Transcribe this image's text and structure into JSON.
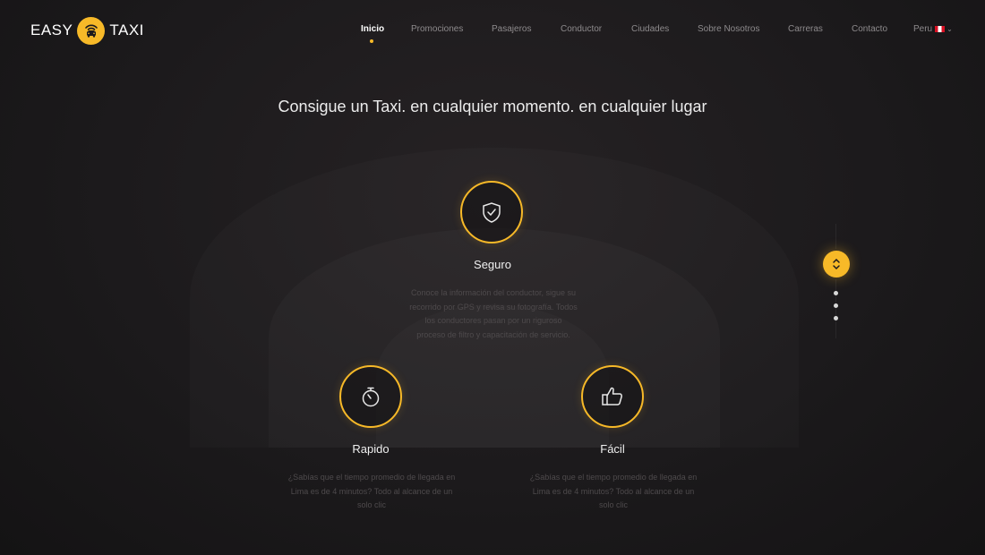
{
  "logo": {
    "left": "EASY",
    "right": "TAXI"
  },
  "nav": {
    "items": [
      {
        "label": "Inicio"
      },
      {
        "label": "Promociones"
      },
      {
        "label": "Pasajeros"
      },
      {
        "label": "Conductor"
      },
      {
        "label": "Ciudades"
      },
      {
        "label": "Sobre Nosotros"
      },
      {
        "label": "Carreras"
      },
      {
        "label": "Contacto"
      }
    ],
    "active_index": 0,
    "country": "Peru"
  },
  "hero": {
    "headline": "Consigue un Taxi. en cualquier momento. en cualquier lugar"
  },
  "features": {
    "seguro": {
      "title": "Seguro",
      "icon": "shield-check-icon",
      "lines": [
        "Conoce la información del conductor, sigue su",
        "recorrido por GPS y revisa su fotografía. Todos",
        "los conductores pasan por un riguroso",
        "proceso de filtro y capacitación de servicio."
      ]
    },
    "rapido": {
      "title": "Rapido",
      "icon": "stopwatch-icon",
      "lines": [
        "¿Sabías que el tiempo promedio de llegada en",
        "Lima es de 4 minutos? Todo al alcance de un",
        "solo clic"
      ]
    },
    "facil": {
      "title": "Fácil",
      "icon": "thumbs-up-icon",
      "lines": [
        "¿Sabías que el tiempo promedio de llegada en",
        "Lima es de 4 minutos? Todo al alcance de un",
        "solo clic"
      ]
    }
  },
  "colors": {
    "accent": "#f7b928",
    "background": "#1c1a1c"
  },
  "pager": {
    "dots": 3
  }
}
